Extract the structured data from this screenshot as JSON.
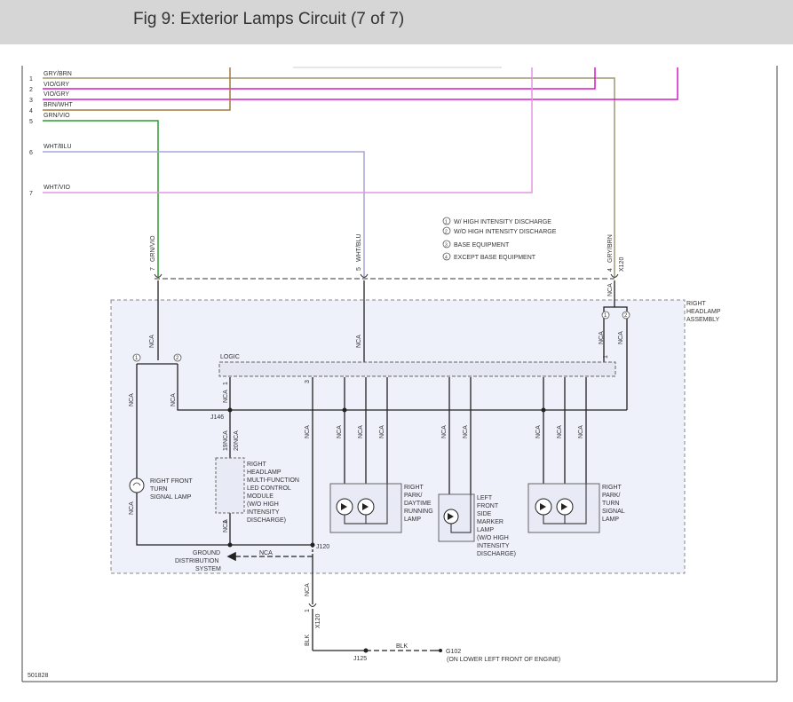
{
  "header": {
    "title": "Fig 9: Exterior Lamps Circuit (7 of 7)"
  },
  "colors": {
    "gry_brn": "#9e9a72",
    "vio_gry": "#d51ac7",
    "brn_wht": "#a17b40",
    "grn_vio": "#2e9a2e",
    "wht_blu": "#a6a6d6",
    "wht_vio": "#e396e3",
    "black": "#222222",
    "assembly_fill": "#eef0fa",
    "assembly_border": "#777777"
  },
  "wires": [
    {
      "num": "1",
      "label": "GRY/BRN"
    },
    {
      "num": "2",
      "label": "VIO/GRY"
    },
    {
      "num": "3",
      "label": "VIO/GRY"
    },
    {
      "num": "4",
      "label": "BRN/WHT"
    },
    {
      "num": "5",
      "label": "GRN/VIO"
    },
    {
      "num": "6",
      "label": "WHT/BLU"
    },
    {
      "num": "7",
      "label": "WHT/VIO"
    }
  ],
  "legend": [
    {
      "num": "1",
      "text": "W/ HIGH INTENSITY DISCHARGE"
    },
    {
      "num": "2",
      "text": "W/O HIGH INTENSITY DISCHARGE"
    },
    {
      "num": "3",
      "text": "BASE EQUIPMENT"
    },
    {
      "num": "4",
      "text": "EXCEPT BASE EQUIPMENT"
    }
  ],
  "connector": {
    "pin7": "7",
    "wire7": "GRN/VIO",
    "pin5": "5",
    "wire5": "WHT/BLU",
    "pin4": "4",
    "wire4": "GRY/BRN",
    "name": "X120"
  },
  "assembly_label": [
    "RIGHT",
    "HEADLAMP",
    "ASSEMBLY"
  ],
  "logic_label": "LOGIC",
  "nca": "NCA",
  "variant_marks": {
    "one": "1",
    "two": "2"
  },
  "pins": {
    "j146_pin1": "1",
    "j146_pin19": "19",
    "j146_pin20": "20",
    "module_pin1": "1",
    "logic_pin3": "3",
    "logic_pin1": "1",
    "x120_pin1": "1"
  },
  "splices": {
    "j146": "J146",
    "j120": "J120",
    "j125": "J125"
  },
  "x120_lower": "X120",
  "components": {
    "turn_lamp": [
      "RIGHT FRONT",
      "TURN",
      "SIGNAL LAMP"
    ],
    "module": [
      "RIGHT",
      "HEADLAMP",
      "MULTI-FUNCTION",
      "LED CONTROL",
      "MODULE",
      "(W/O HIGH",
      "INTENSITY",
      "DISCHARGE)"
    ],
    "park_drl": [
      "RIGHT",
      "PARK/",
      "DAYTIME",
      "RUNNING",
      "LAMP"
    ],
    "side_marker": [
      "LEFT",
      "FRONT",
      "SIDE",
      "MARKER",
      "LAMP",
      "(W/O HIGH",
      "INTENSITY",
      "DISCHARGE)"
    ],
    "park_turn": [
      "RIGHT",
      "PARK/",
      "TURN",
      "SIGNAL",
      "LAMP"
    ]
  },
  "ground": {
    "system": [
      "GROUND",
      "DISTRIBUTION",
      "SYSTEM"
    ],
    "blk": "BLK",
    "g102": "G102",
    "g102_location": "(ON LOWER LEFT FRONT OF ENGINE)"
  },
  "figure_id": "501828"
}
